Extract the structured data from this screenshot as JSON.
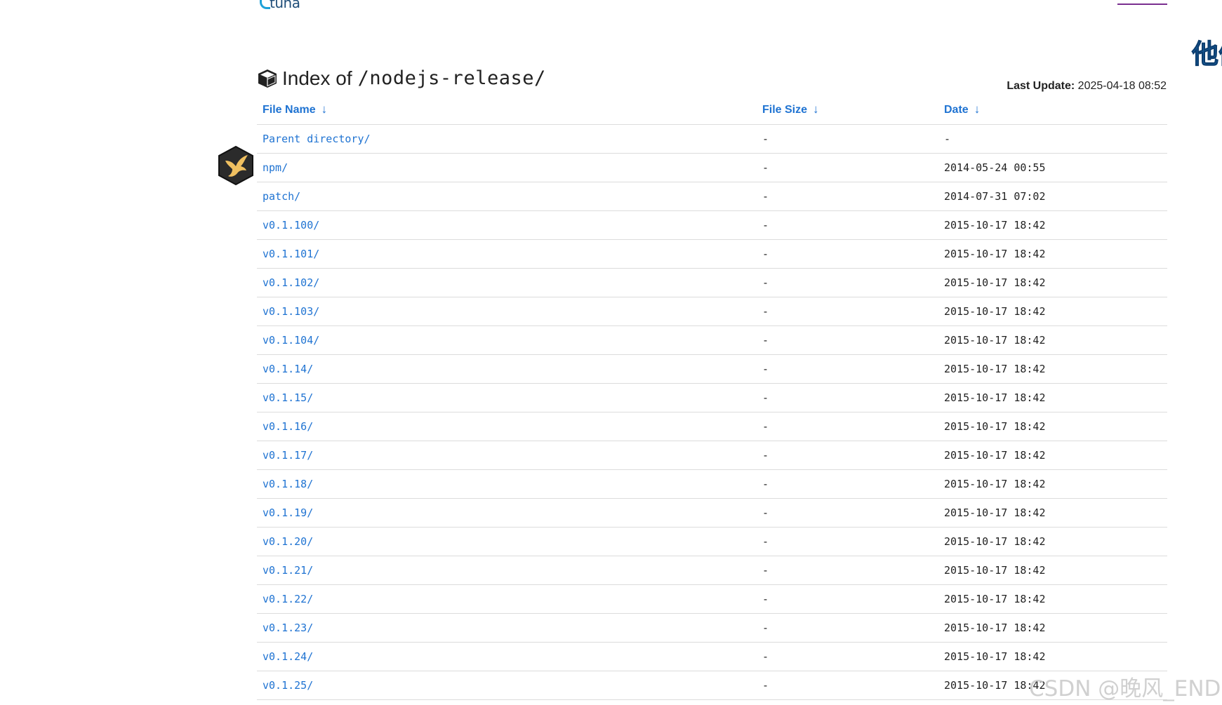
{
  "logo": {
    "text": "tuna"
  },
  "side_text": "他们",
  "header": {
    "title_prefix": "Index of",
    "title_path": "/nodejs-release/",
    "last_update_label": "Last Update:",
    "last_update_value": "2025-04-18 08:52"
  },
  "table": {
    "columns": [
      {
        "label": "File Name",
        "arrow": "↓"
      },
      {
        "label": "File Size",
        "arrow": "↓"
      },
      {
        "label": "Date",
        "arrow": "↓"
      }
    ],
    "rows": [
      {
        "name": "Parent directory/",
        "size": "-",
        "date": "-"
      },
      {
        "name": "npm/",
        "size": "-",
        "date": "2014-05-24 00:55"
      },
      {
        "name": "patch/",
        "size": "-",
        "date": "2014-07-31 07:02"
      },
      {
        "name": "v0.1.100/",
        "size": "-",
        "date": "2015-10-17 18:42"
      },
      {
        "name": "v0.1.101/",
        "size": "-",
        "date": "2015-10-17 18:42"
      },
      {
        "name": "v0.1.102/",
        "size": "-",
        "date": "2015-10-17 18:42"
      },
      {
        "name": "v0.1.103/",
        "size": "-",
        "date": "2015-10-17 18:42"
      },
      {
        "name": "v0.1.104/",
        "size": "-",
        "date": "2015-10-17 18:42"
      },
      {
        "name": "v0.1.14/",
        "size": "-",
        "date": "2015-10-17 18:42"
      },
      {
        "name": "v0.1.15/",
        "size": "-",
        "date": "2015-10-17 18:42"
      },
      {
        "name": "v0.1.16/",
        "size": "-",
        "date": "2015-10-17 18:42"
      },
      {
        "name": "v0.1.17/",
        "size": "-",
        "date": "2015-10-17 18:42"
      },
      {
        "name": "v0.1.18/",
        "size": "-",
        "date": "2015-10-17 18:42"
      },
      {
        "name": "v0.1.19/",
        "size": "-",
        "date": "2015-10-17 18:42"
      },
      {
        "name": "v0.1.20/",
        "size": "-",
        "date": "2015-10-17 18:42"
      },
      {
        "name": "v0.1.21/",
        "size": "-",
        "date": "2015-10-17 18:42"
      },
      {
        "name": "v0.1.22/",
        "size": "-",
        "date": "2015-10-17 18:42"
      },
      {
        "name": "v0.1.23/",
        "size": "-",
        "date": "2015-10-17 18:42"
      },
      {
        "name": "v0.1.24/",
        "size": "-",
        "date": "2015-10-17 18:42"
      },
      {
        "name": "v0.1.25/",
        "size": "-",
        "date": "2015-10-17 18:42"
      }
    ]
  },
  "watermark": "CSDN @晚风_END",
  "icons": {
    "title_icon": "package-box-icon",
    "floating_badge": "bird-hexagon-icon"
  },
  "colors": {
    "link": "#1f73d2",
    "nav_underline": "#7a2f8f",
    "badge_bg": "#2b2b2b",
    "badge_bird": "#f0c060"
  }
}
